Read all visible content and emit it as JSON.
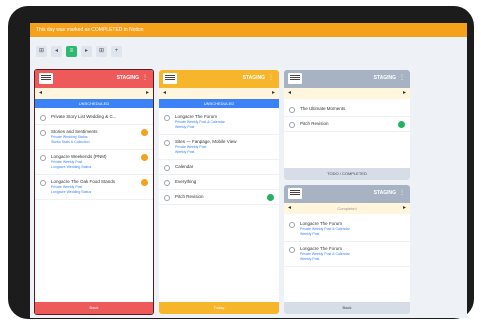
{
  "banner": {
    "text": "This day was marked as COMPLETED in Notion"
  },
  "toolbar": {
    "buttons": [
      {
        "glyph": "⊞",
        "icon": "grid-icon"
      },
      {
        "glyph": "◂",
        "icon": "back-icon"
      },
      {
        "glyph": "≡",
        "icon": "list-icon",
        "active": true
      },
      {
        "glyph": "▸",
        "icon": "forward-icon"
      },
      {
        "glyph": "⊞",
        "icon": "calendar-icon"
      },
      {
        "glyph": "+",
        "icon": "add-icon"
      }
    ]
  },
  "colors": {
    "red_head": "#ee5a5a",
    "yellow_head": "#f6b52a",
    "gray_head": "#a7b3c2",
    "blue": "#3b82f6",
    "orange_badge": "#f5a11c",
    "green_badge": "#22b35e"
  },
  "col1": {
    "title": "STAGING",
    "nav_mid": "",
    "section": "UNSCHEDULED",
    "items": [
      {
        "title": "Private Story List Wedding & C...",
        "sub": "",
        "badge": ""
      },
      {
        "title": "Stories and Sentiments",
        "sub": "Private Wedding Status",
        "sub2": "Studio Stats & Collection",
        "badge": "orange"
      },
      {
        "title": "Longacre Weekends (PNM)",
        "sub": "Private Weekly Post",
        "sub2": "Longacre Wedding Status",
        "badge": "orange"
      },
      {
        "title": "Longacre The Oak Food Stands",
        "sub": "Private Weekly Post",
        "sub2": "Longacre Wedding Status",
        "badge": "orange"
      }
    ],
    "footer": "Back"
  },
  "col2": {
    "title": "STAGING",
    "section": "UNSCHEDULED",
    "items": [
      {
        "title": "Longacre The Forum",
        "sub": "Private Weekly Post & Calendar",
        "sub2": "Weekly Post",
        "badge": ""
      },
      {
        "title": "Sites — Fanpage, Mobile View",
        "sub": "Private Weekly Post",
        "sub2": "Weekly Post",
        "badge": ""
      },
      {
        "title": "Calendar",
        "sub": "",
        "badge": ""
      },
      {
        "title": "Everything",
        "sub": "",
        "badge": ""
      },
      {
        "title": "Pitch Revision",
        "sub": "",
        "badge": "green"
      }
    ],
    "footer": "Today"
  },
  "col3": {
    "title": "STAGING",
    "items": [
      {
        "title": "The Ultimate Moments",
        "sub": "",
        "badge": ""
      },
      {
        "title": "Pitch Revision",
        "sub": "",
        "badge": "green"
      }
    ],
    "divider": "TODO / COMPLETED"
  },
  "col4": {
    "title": "STAGING",
    "nav_mid": "Completed",
    "items": [
      {
        "title": "Longacre The Forum",
        "sub": "Private Weekly Post & Calendar",
        "sub2": "Weekly Post",
        "badge": ""
      },
      {
        "title": "Longacre The Forum",
        "sub": "Private Weekly Post & Calendar",
        "sub2": "Weekly Post",
        "badge": ""
      }
    ],
    "footer": "Back"
  }
}
